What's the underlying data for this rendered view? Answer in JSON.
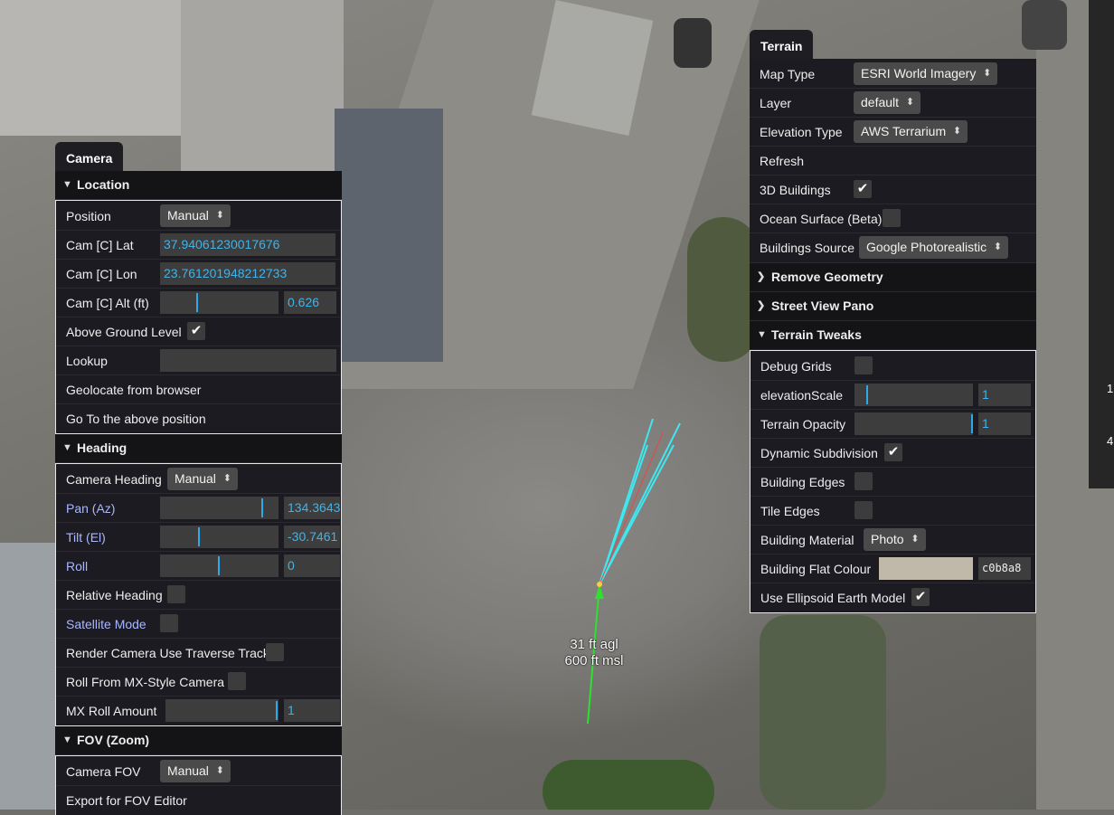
{
  "colors": {
    "panel_bg": "#1a1a1e",
    "accent": "#41b3e8",
    "flat_colour": "#c0b8a8"
  },
  "overlay": {
    "agl": "31 ft agl",
    "msl": "600 ft msl"
  },
  "edge_glyphs": {
    "a": "1",
    "b": "4"
  },
  "camera": {
    "tab": "Camera",
    "location": {
      "title": "Location",
      "position_label": "Position",
      "position_value": "Manual",
      "lat_label": "Cam [C] Lat",
      "lat_value": "37.94061230017676",
      "lon_label": "Cam [C] Lon",
      "lon_value": "23.761201948212733",
      "alt_label": "Cam [C] Alt (ft)",
      "alt_value": "0.626",
      "agl_label": "Above Ground Level",
      "agl_checked": true,
      "lookup_label": "Lookup",
      "geolocate_label": "Geolocate from browser",
      "goto_label": "Go To the above position"
    },
    "heading": {
      "title": "Heading",
      "camera_heading_label": "Camera Heading",
      "camera_heading_value": "Manual",
      "pan_label": "Pan (Az)",
      "pan_value": "134.3643",
      "tilt_label": "Tilt (El)",
      "tilt_value": "-30.7461",
      "roll_label": "Roll",
      "roll_value": "0",
      "relative_heading_label": "Relative Heading",
      "satellite_mode_label": "Satellite Mode",
      "traverse_label": "Render Camera Use Traverse Track",
      "mx_roll_from_label": "Roll From MX-Style Camera",
      "mx_roll_amount_label": "MX Roll Amount",
      "mx_roll_amount_value": "1"
    },
    "fov": {
      "title": "FOV (Zoom)",
      "camera_fov_label": "Camera FOV",
      "camera_fov_value": "Manual",
      "export_label": "Export for FOV Editor"
    }
  },
  "terrain": {
    "tab": "Terrain",
    "map_type_label": "Map Type",
    "map_type_value": "ESRI World Imagery",
    "layer_label": "Layer",
    "layer_value": "default",
    "elevation_type_label": "Elevation Type",
    "elevation_type_value": "AWS Terrarium",
    "refresh_label": "Refresh",
    "buildings_3d_label": "3D Buildings",
    "buildings_3d_checked": true,
    "ocean_label": "Ocean Surface (Beta)",
    "buildings_source_label": "Buildings Source",
    "buildings_source_value": "Google Photorealistic",
    "remove_geometry": "Remove Geometry",
    "street_view": "Street View Pano",
    "tweaks": {
      "title": "Terrain Tweaks",
      "debug_grids_label": "Debug Grids",
      "elevation_scale_label": "elevationScale",
      "elevation_scale_value": "1",
      "opacity_label": "Terrain Opacity",
      "opacity_value": "1",
      "dynamic_subdivision_label": "Dynamic Subdivision",
      "dynamic_subdivision_checked": true,
      "building_edges_label": "Building Edges",
      "tile_edges_label": "Tile Edges",
      "building_material_label": "Building Material",
      "building_material_value": "Photo",
      "flat_colour_label": "Building Flat Colour",
      "flat_colour_value": "c0b8a8",
      "ellipsoid_label": "Use Ellipsoid Earth Model",
      "ellipsoid_checked": true
    }
  }
}
